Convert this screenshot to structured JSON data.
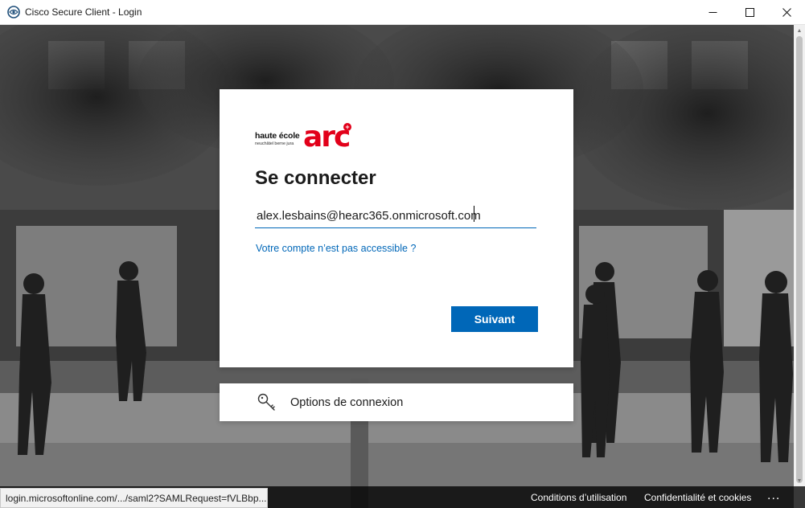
{
  "window": {
    "title": "Cisco Secure Client - Login"
  },
  "colors": {
    "accent": "#0067b8",
    "brand_red": "#e2001a"
  },
  "logo": {
    "line1": "haute école",
    "line2": "neuchâtel berne jura",
    "arc": "arc",
    "plus": "+"
  },
  "login": {
    "heading": "Se connecter",
    "email_value": "alex.lesbains@hearc365.onmicrosoft.com",
    "account_link": "Votre compte n’est pas accessible ?",
    "next_button": "Suivant"
  },
  "options": {
    "label": "Options de connexion",
    "icon": "key-icon"
  },
  "footer": {
    "status_url": "login.microsoftonline.com/.../saml2?SAMLRequest=fVLBbp...",
    "terms": "Conditions d’utilisation",
    "privacy": "Confidentialité et cookies",
    "more": "..."
  }
}
